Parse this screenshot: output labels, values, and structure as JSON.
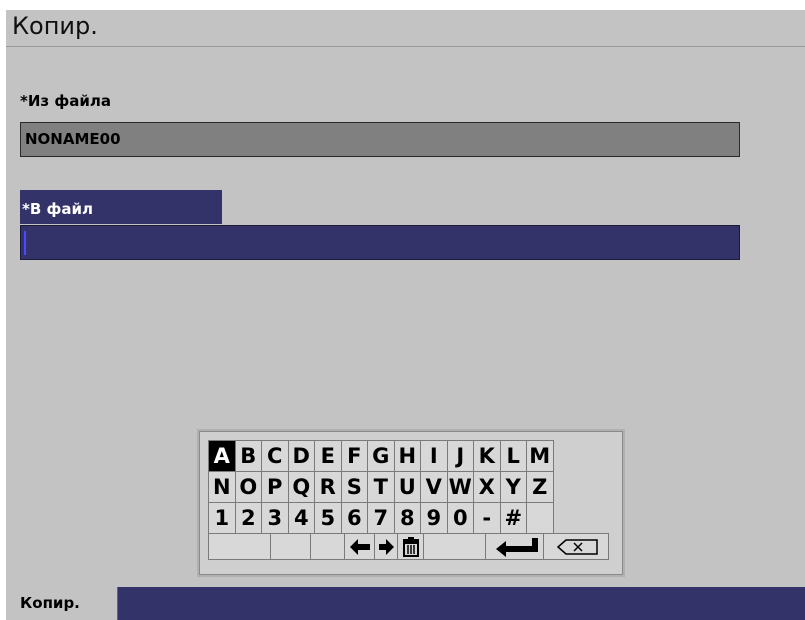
{
  "title": "Копир.",
  "from_label": "*Из файла",
  "from_value": "NONAME00",
  "to_label": "*В файл",
  "to_value": "",
  "keyboard": {
    "row1": [
      "A",
      "B",
      "C",
      "D",
      "E",
      "F",
      "G",
      "H",
      "I",
      "J",
      "K",
      "L",
      "M"
    ],
    "row2": [
      "N",
      "O",
      "P",
      "Q",
      "R",
      "S",
      "T",
      "U",
      "V",
      "W",
      "X",
      "Y",
      "Z"
    ],
    "row3": [
      "1",
      "2",
      "3",
      "4",
      "5",
      "6",
      "7",
      "8",
      "9",
      "0",
      "-",
      "#",
      ""
    ],
    "selected": "A",
    "icons": [
      "left-arrow-icon",
      "right-arrow-icon",
      "trash-icon",
      "enter-icon",
      "backspace-icon"
    ]
  },
  "bottom_tab": "Копир.",
  "colors": {
    "panel": "#c3c3c3",
    "accent": "#33336a",
    "field_inactive": "#808080"
  }
}
